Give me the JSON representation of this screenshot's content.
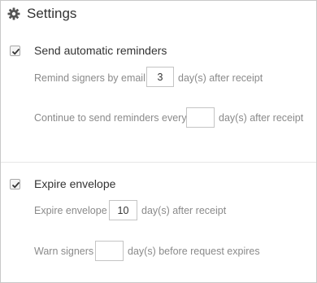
{
  "header": {
    "title": "Settings",
    "icon": "gear-icon"
  },
  "reminders": {
    "checked": true,
    "label": "Send automatic reminders",
    "remind_prefix": "Remind signers by email",
    "remind_value": "3",
    "remind_suffix": "day(s) after receipt",
    "continue_prefix": "Continue to send reminders every",
    "continue_value": "",
    "continue_suffix": "day(s) after receipt"
  },
  "expire": {
    "checked": true,
    "label": "Expire envelope",
    "expire_prefix": "Expire envelope",
    "expire_value": "10",
    "expire_suffix": "day(s) after receipt",
    "warn_prefix": "Warn signers",
    "warn_value": "",
    "warn_suffix": "day(s) before request expires"
  },
  "colors": {
    "text": "#333333",
    "muted": "#8a8a8a",
    "border": "#c4c4c4"
  }
}
